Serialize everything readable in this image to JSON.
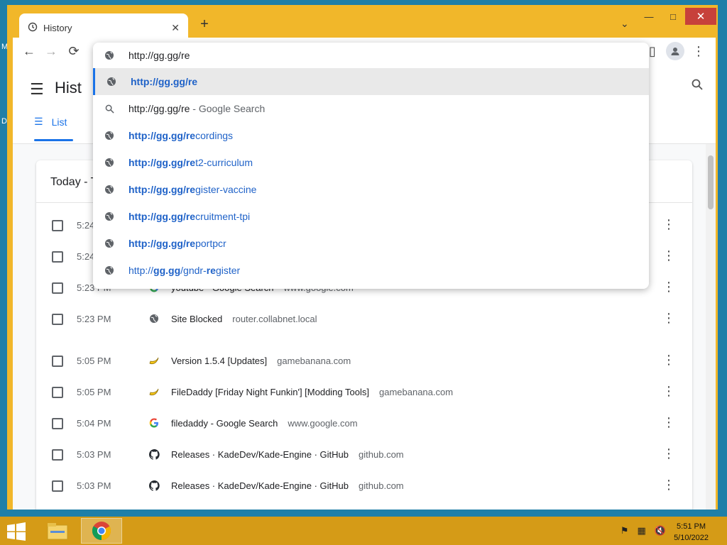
{
  "desktop": {
    "marks": [
      "M",
      "D"
    ]
  },
  "window": {
    "caption": {
      "minimize": "—",
      "maximize": "□",
      "close": "✕"
    }
  },
  "tab": {
    "title": "History",
    "close": "✕",
    "new_tab": "+",
    "tab_search": "⌄"
  },
  "toolbar": {
    "back": "←",
    "forward": "→",
    "reload": "⟳",
    "sidepanel": "▯",
    "menu": "⋮"
  },
  "omnibox": {
    "value": "http://gg.gg/re",
    "suggestions": [
      {
        "bold": "http://gg.gg/re",
        "rest": "",
        "icon": "globe-icon",
        "selected": true
      },
      {
        "plain": "http://gg.gg/re",
        "sub": " - Google Search",
        "icon": "search-icon"
      },
      {
        "bold": "http://gg.gg/re",
        "rest": "cordings",
        "icon": "globe-icon"
      },
      {
        "bold": "http://gg.gg/re",
        "rest": "t2-curriculum",
        "icon": "globe-icon"
      },
      {
        "bold": "http://gg.gg/re",
        "rest": "gister-vaccine",
        "icon": "globe-icon"
      },
      {
        "bold": "http://gg.gg/re",
        "rest": "cruitment-tpi",
        "icon": "globe-icon"
      },
      {
        "bold": "http://gg.gg/re",
        "rest": "portpcr",
        "icon": "globe-icon"
      },
      {
        "parts": [
          "http://",
          "gg.gg",
          "/gndr-",
          "re",
          "gister"
        ],
        "icon": "globe-icon"
      }
    ]
  },
  "history": {
    "title": "Hist",
    "list_tab": "List",
    "card_header": "Today - T",
    "rows": [
      {
        "time": "5:24",
        "title": "",
        "domain": "",
        "icon": ""
      },
      {
        "time": "5:24",
        "title": "",
        "domain": "",
        "icon": ""
      },
      {
        "time": "5:23 PM",
        "title": "youtube - Google Search",
        "domain": "www.google.com",
        "icon": "google-icon"
      },
      {
        "time": "5:23 PM",
        "title": "Site Blocked",
        "domain": "router.collabnet.local",
        "icon": "globe-icon"
      },
      {
        "time": "5:05 PM",
        "title": "Version 1.5.4 [Updates]",
        "domain": "gamebanana.com",
        "icon": "banana-icon"
      },
      {
        "time": "5:05 PM",
        "title": "FileDaddy [Friday Night Funkin'] [Modding Tools]",
        "domain": "gamebanana.com",
        "icon": "banana-icon"
      },
      {
        "time": "5:04 PM",
        "title": "filedaddy - Google Search",
        "domain": "www.google.com",
        "icon": "google-icon"
      },
      {
        "time": "5:03 PM",
        "title": "Releases · KadeDev/Kade-Engine · GitHub",
        "domain": "github.com",
        "icon": "github-icon"
      },
      {
        "time": "5:03 PM",
        "title": "Releases · KadeDev/Kade-Engine · GitHub",
        "domain": "github.com",
        "icon": "github-icon"
      }
    ]
  },
  "taskbar": {
    "time": "5:51 PM",
    "date": "5/10/2022"
  }
}
